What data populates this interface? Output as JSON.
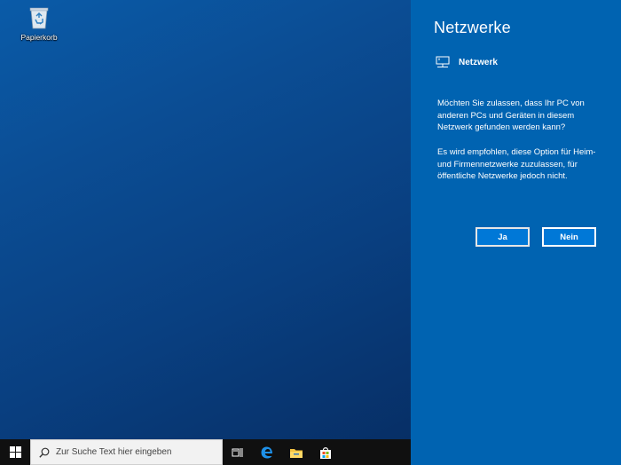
{
  "desktop": {
    "icons": [
      {
        "label": "Papierkorb",
        "icon": "recycle-bin-icon"
      }
    ]
  },
  "flyout": {
    "title": "Netzwerke",
    "network": {
      "name": "Netzwerk",
      "icon": "network-icon"
    },
    "question": "Möchten Sie zulassen, dass Ihr PC von anderen PCs und Geräten in diesem Netzwerk gefunden werden kann?",
    "recommendation": "Es wird empfohlen, diese Option für Heim- und Firmennetzwerke zuzulassen, für öffentliche Netzwerke jedoch nicht.",
    "yes_label": "Ja",
    "no_label": "Nein",
    "background": "#0063b1"
  },
  "taskbar": {
    "search_placeholder": "Zur Suche Text hier eingeben",
    "items": [
      "start-icon",
      "task-view-icon",
      "edge-icon",
      "file-explorer-icon",
      "store-icon"
    ]
  }
}
